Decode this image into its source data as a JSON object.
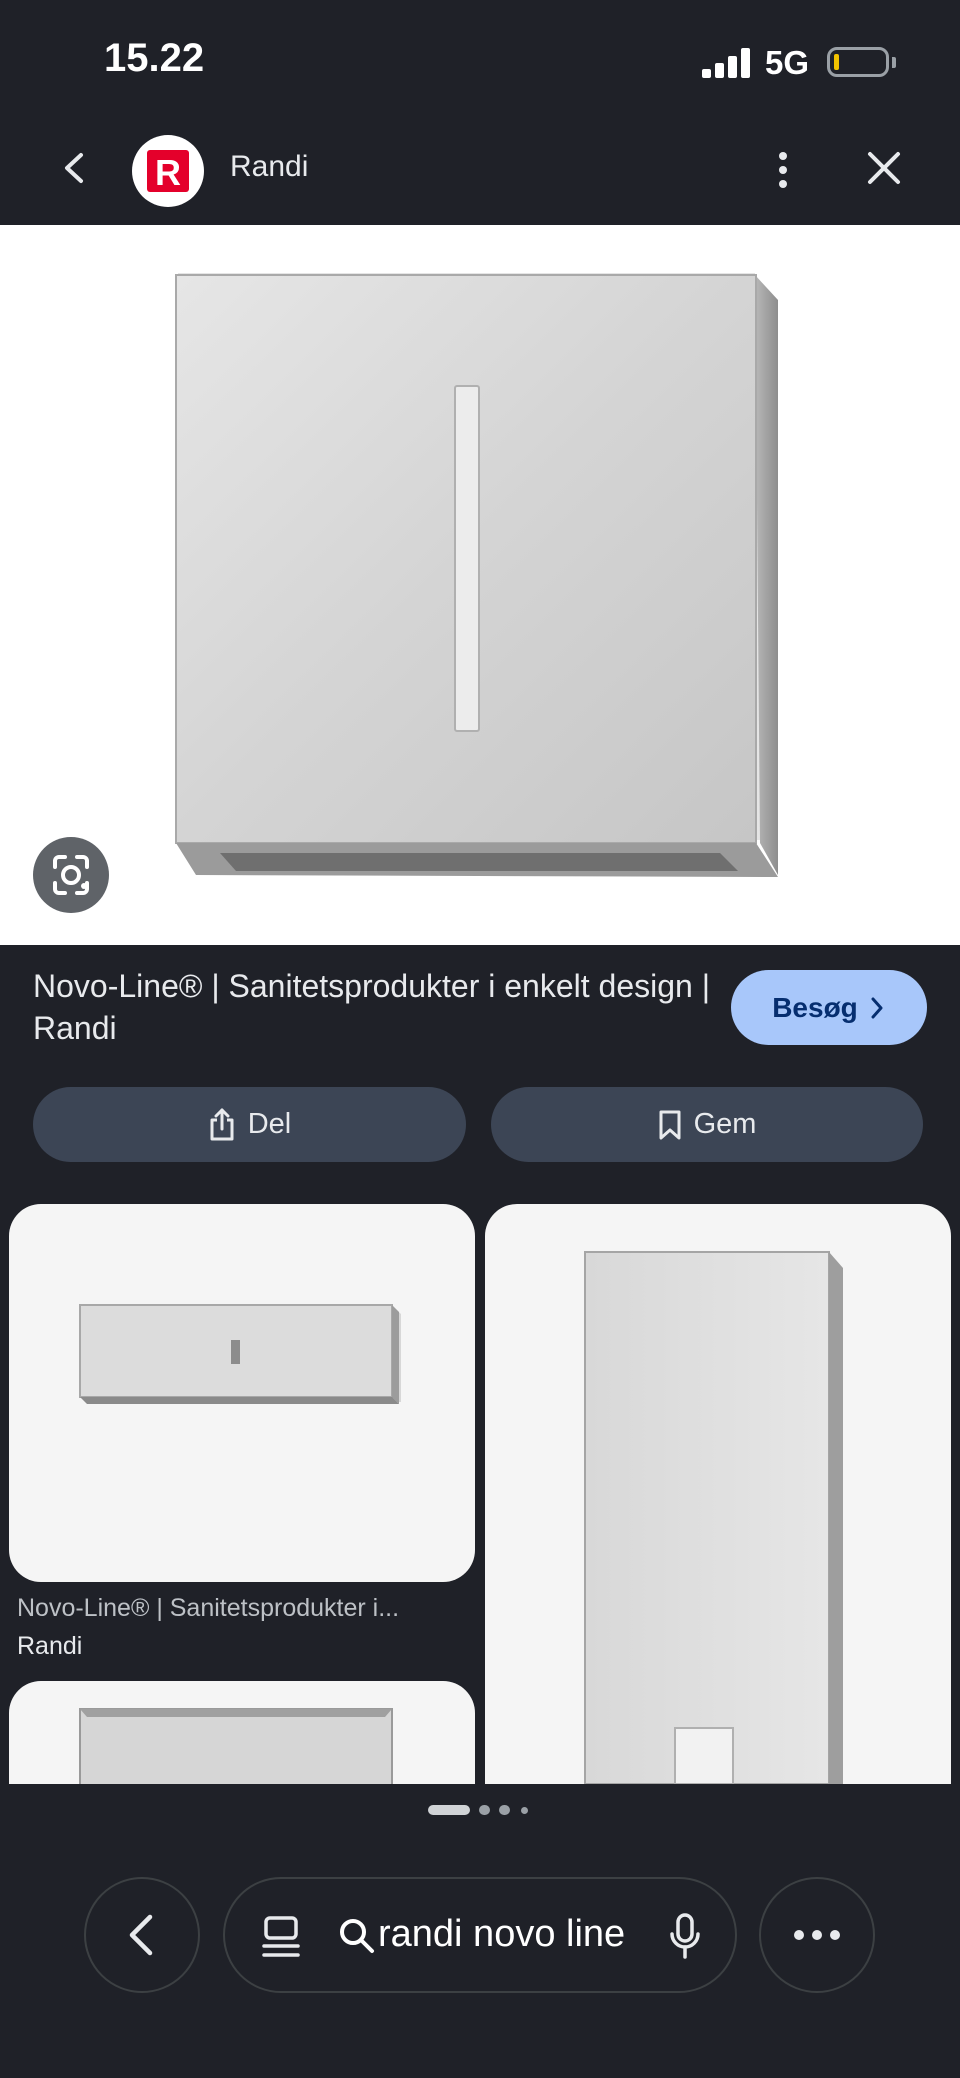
{
  "status_bar": {
    "time": "15.22",
    "network": "5G"
  },
  "header": {
    "site_name": "Randi",
    "logo_letter": "R",
    "brand_color": "#e4002b"
  },
  "result": {
    "title": "Novo-Line® | Sanitetsprodukter i enkelt design | Randi",
    "visit_label": "Besøg",
    "share_label": "Del",
    "save_label": "Gem"
  },
  "related": [
    {
      "title": "Novo-Line® | Sanitetsprodukter i...",
      "source": "Randi"
    }
  ],
  "search": {
    "query": "randi novo line"
  },
  "icons": [
    "back-arrow-icon",
    "more-vert-icon",
    "close-icon",
    "lens-icon",
    "share-icon",
    "bookmark-icon",
    "tabs-icon",
    "search-icon",
    "mic-icon",
    "more-horiz-icon"
  ],
  "colors": {
    "background": "#1f2128",
    "accent": "#a8c7fa",
    "pill": "#3c4555"
  }
}
